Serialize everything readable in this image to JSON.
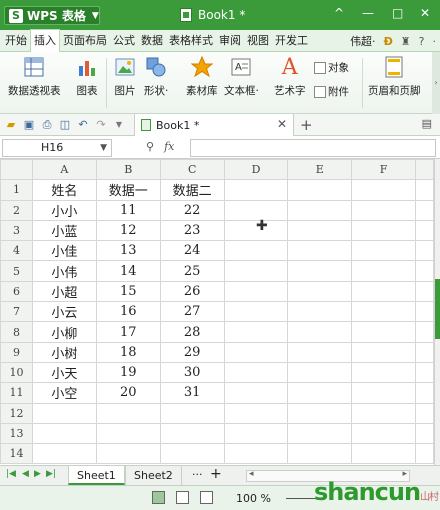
{
  "titlebar": {
    "app_label": "WPS 表格",
    "doc_title": "Book1 *",
    "controls": [
      "^",
      "—",
      "□",
      "✕"
    ]
  },
  "menu": {
    "items": [
      "开始",
      "插入",
      "页面布局",
      "公式",
      "数据",
      "表格样式",
      "审阅",
      "视图",
      "开发工"
    ],
    "active": "插入",
    "user": "伟超·",
    "right_icons": [
      "theme-icon",
      "shirt-icon",
      "help-icon",
      "more-icon"
    ]
  },
  "ribbon": {
    "pivot": "数据透视表",
    "chart": "图表",
    "picture": "图片",
    "shapes": "形状",
    "material": "素材库",
    "textbox": "文本框",
    "arttext": "艺术字",
    "object": "对象",
    "attachment": "附件",
    "header_footer": "页眉和页脚"
  },
  "quickbar": {
    "tab_label": "Book1 *",
    "add": "+"
  },
  "formula_bar": {
    "cell_ref": "H16",
    "fx": "fx",
    "value": ""
  },
  "sheet": {
    "columns": [
      "A",
      "B",
      "C",
      "D",
      "E",
      "F"
    ],
    "rows": [
      [
        "1",
        "姓名",
        "数据一",
        "数据二"
      ],
      [
        "2",
        "小小",
        "11",
        "22"
      ],
      [
        "3",
        "小蓝",
        "12",
        "23"
      ],
      [
        "4",
        "小佳",
        "13",
        "24"
      ],
      [
        "5",
        "小伟",
        "14",
        "25"
      ],
      [
        "6",
        "小超",
        "15",
        "26"
      ],
      [
        "7",
        "小云",
        "16",
        "27"
      ],
      [
        "8",
        "小柳",
        "17",
        "28"
      ],
      [
        "9",
        "小树",
        "18",
        "29"
      ],
      [
        "10",
        "小天",
        "19",
        "30"
      ],
      [
        "11",
        "小空",
        "20",
        "31"
      ],
      [
        "12",
        "",
        "",
        ""
      ],
      [
        "13",
        "",
        "",
        ""
      ],
      [
        "14",
        "",
        "",
        ""
      ]
    ]
  },
  "sheet_tabs": {
    "tabs": [
      "Sheet1",
      "Sheet2"
    ],
    "active": "Sheet1",
    "more": "···",
    "add": "+"
  },
  "status": {
    "zoom": "100 %",
    "watermark": "shancun",
    "watermark_sub": "山村网 .net"
  },
  "colors": {
    "accent": "#3b9b3b",
    "menubar": "#e8f3e8"
  }
}
